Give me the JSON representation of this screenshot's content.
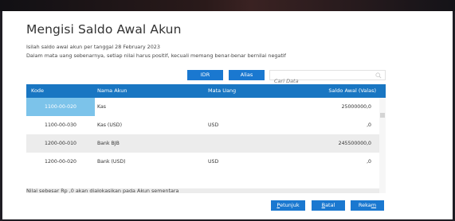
{
  "page": {
    "title": "Mengisi Saldo Awal Akun",
    "info_line1": "Isilah saldo awal akun per tanggal 28 February 2023",
    "info_line2": "Dalam mata uang sebenarnya, setiap nilai harus positif, kecuali memang benar-benar bernilai negatif"
  },
  "toolbar": {
    "idr_label": "IDR",
    "alias_label": "Alias",
    "search_placeholder": "Cari Data",
    "search_icon": "search-icon"
  },
  "table": {
    "headers": {
      "kode": "Kode",
      "nama": "Nama Akun",
      "mata": "Mata Uang",
      "saldo": "Saldo Awal (Valas)"
    },
    "rows": [
      {
        "kode": "1100-00-020",
        "nama": "Kas",
        "mata": "",
        "saldo": "25000000,0"
      },
      {
        "kode": "1100-00-030",
        "nama": "Kas (USD)",
        "mata": "USD",
        "saldo": ",0"
      },
      {
        "kode": "1200-00-010",
        "nama": "Bank BJB",
        "mata": "",
        "saldo": "245500000,0"
      },
      {
        "kode": "1200-00-020",
        "nama": "Bank (USD)",
        "mata": "USD",
        "saldo": ",0"
      }
    ]
  },
  "footer": {
    "note": "Nilai sebesar Rp ,0 akan dialokasikan pada Akun sementara",
    "petunjuk_pre": "",
    "petunjuk_key": "P",
    "petunjuk_post": "etunjuk",
    "batal_pre": "",
    "batal_key": "B",
    "batal_post": "atal",
    "rekam_pre": "Reka",
    "rekam_key": "m",
    "rekam_post": ""
  },
  "colors": {
    "accent": "#1a78d0",
    "header": "#1976c2",
    "selected_cell": "#7cc3ea"
  }
}
